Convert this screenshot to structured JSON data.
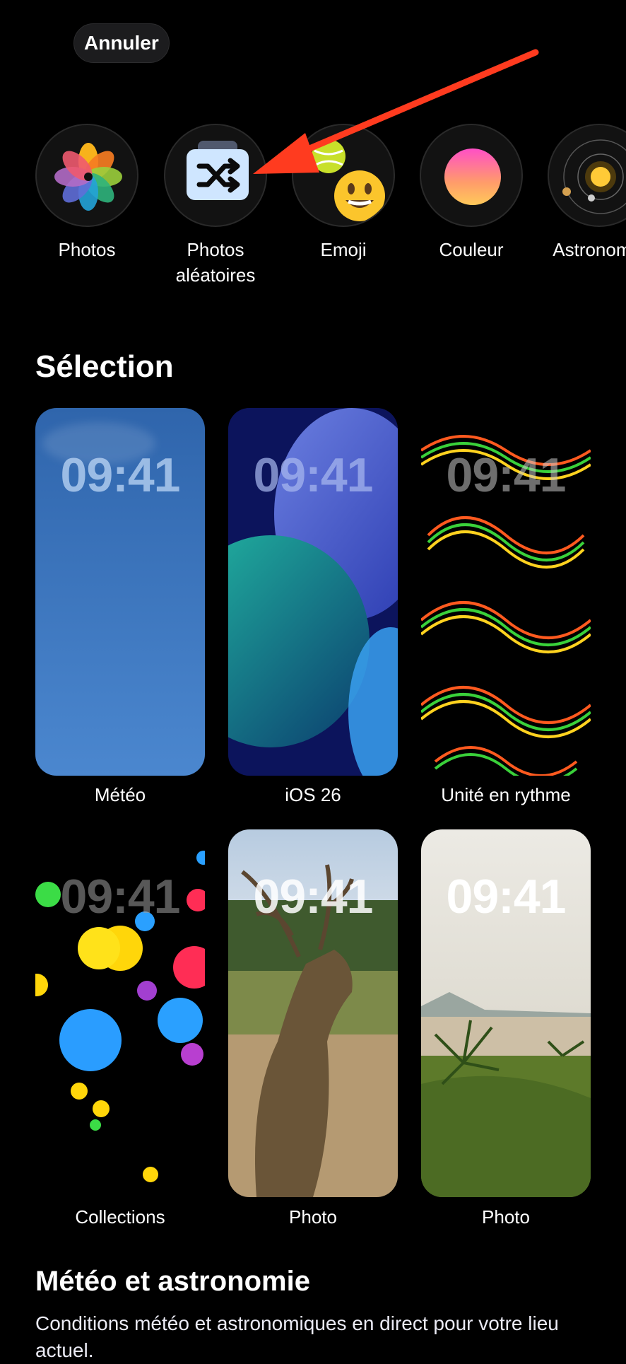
{
  "header": {
    "cancel_label": "Annuler"
  },
  "wallpaper_types": [
    {
      "label": "Photos",
      "icon": "photos-flower-icon"
    },
    {
      "label": "Photos\naléatoires",
      "icon": "shuffle-icon"
    },
    {
      "label": "Emoji",
      "icon": "emoji-icon"
    },
    {
      "label": "Couleur",
      "icon": "color-gradient-icon"
    },
    {
      "label": "Astronomie",
      "icon": "astronomy-icon"
    }
  ],
  "selection": {
    "title": "Sélection",
    "cards": [
      {
        "label": "Météo",
        "time": "09:41"
      },
      {
        "label": "iOS 26",
        "time": "09:41"
      },
      {
        "label": "Unité en rythme",
        "time": "09:41"
      },
      {
        "label": "Collections",
        "time": "09:41"
      },
      {
        "label": "Photo",
        "time": "09:41"
      },
      {
        "label": "Photo",
        "time": "09:41"
      }
    ]
  },
  "weather_section": {
    "title": "Météo et astronomie",
    "description": "Conditions météo et astronomiques en direct pour votre lieu actuel."
  },
  "colors": {
    "annotation_arrow": "#ff3b1f",
    "background": "#000000"
  }
}
